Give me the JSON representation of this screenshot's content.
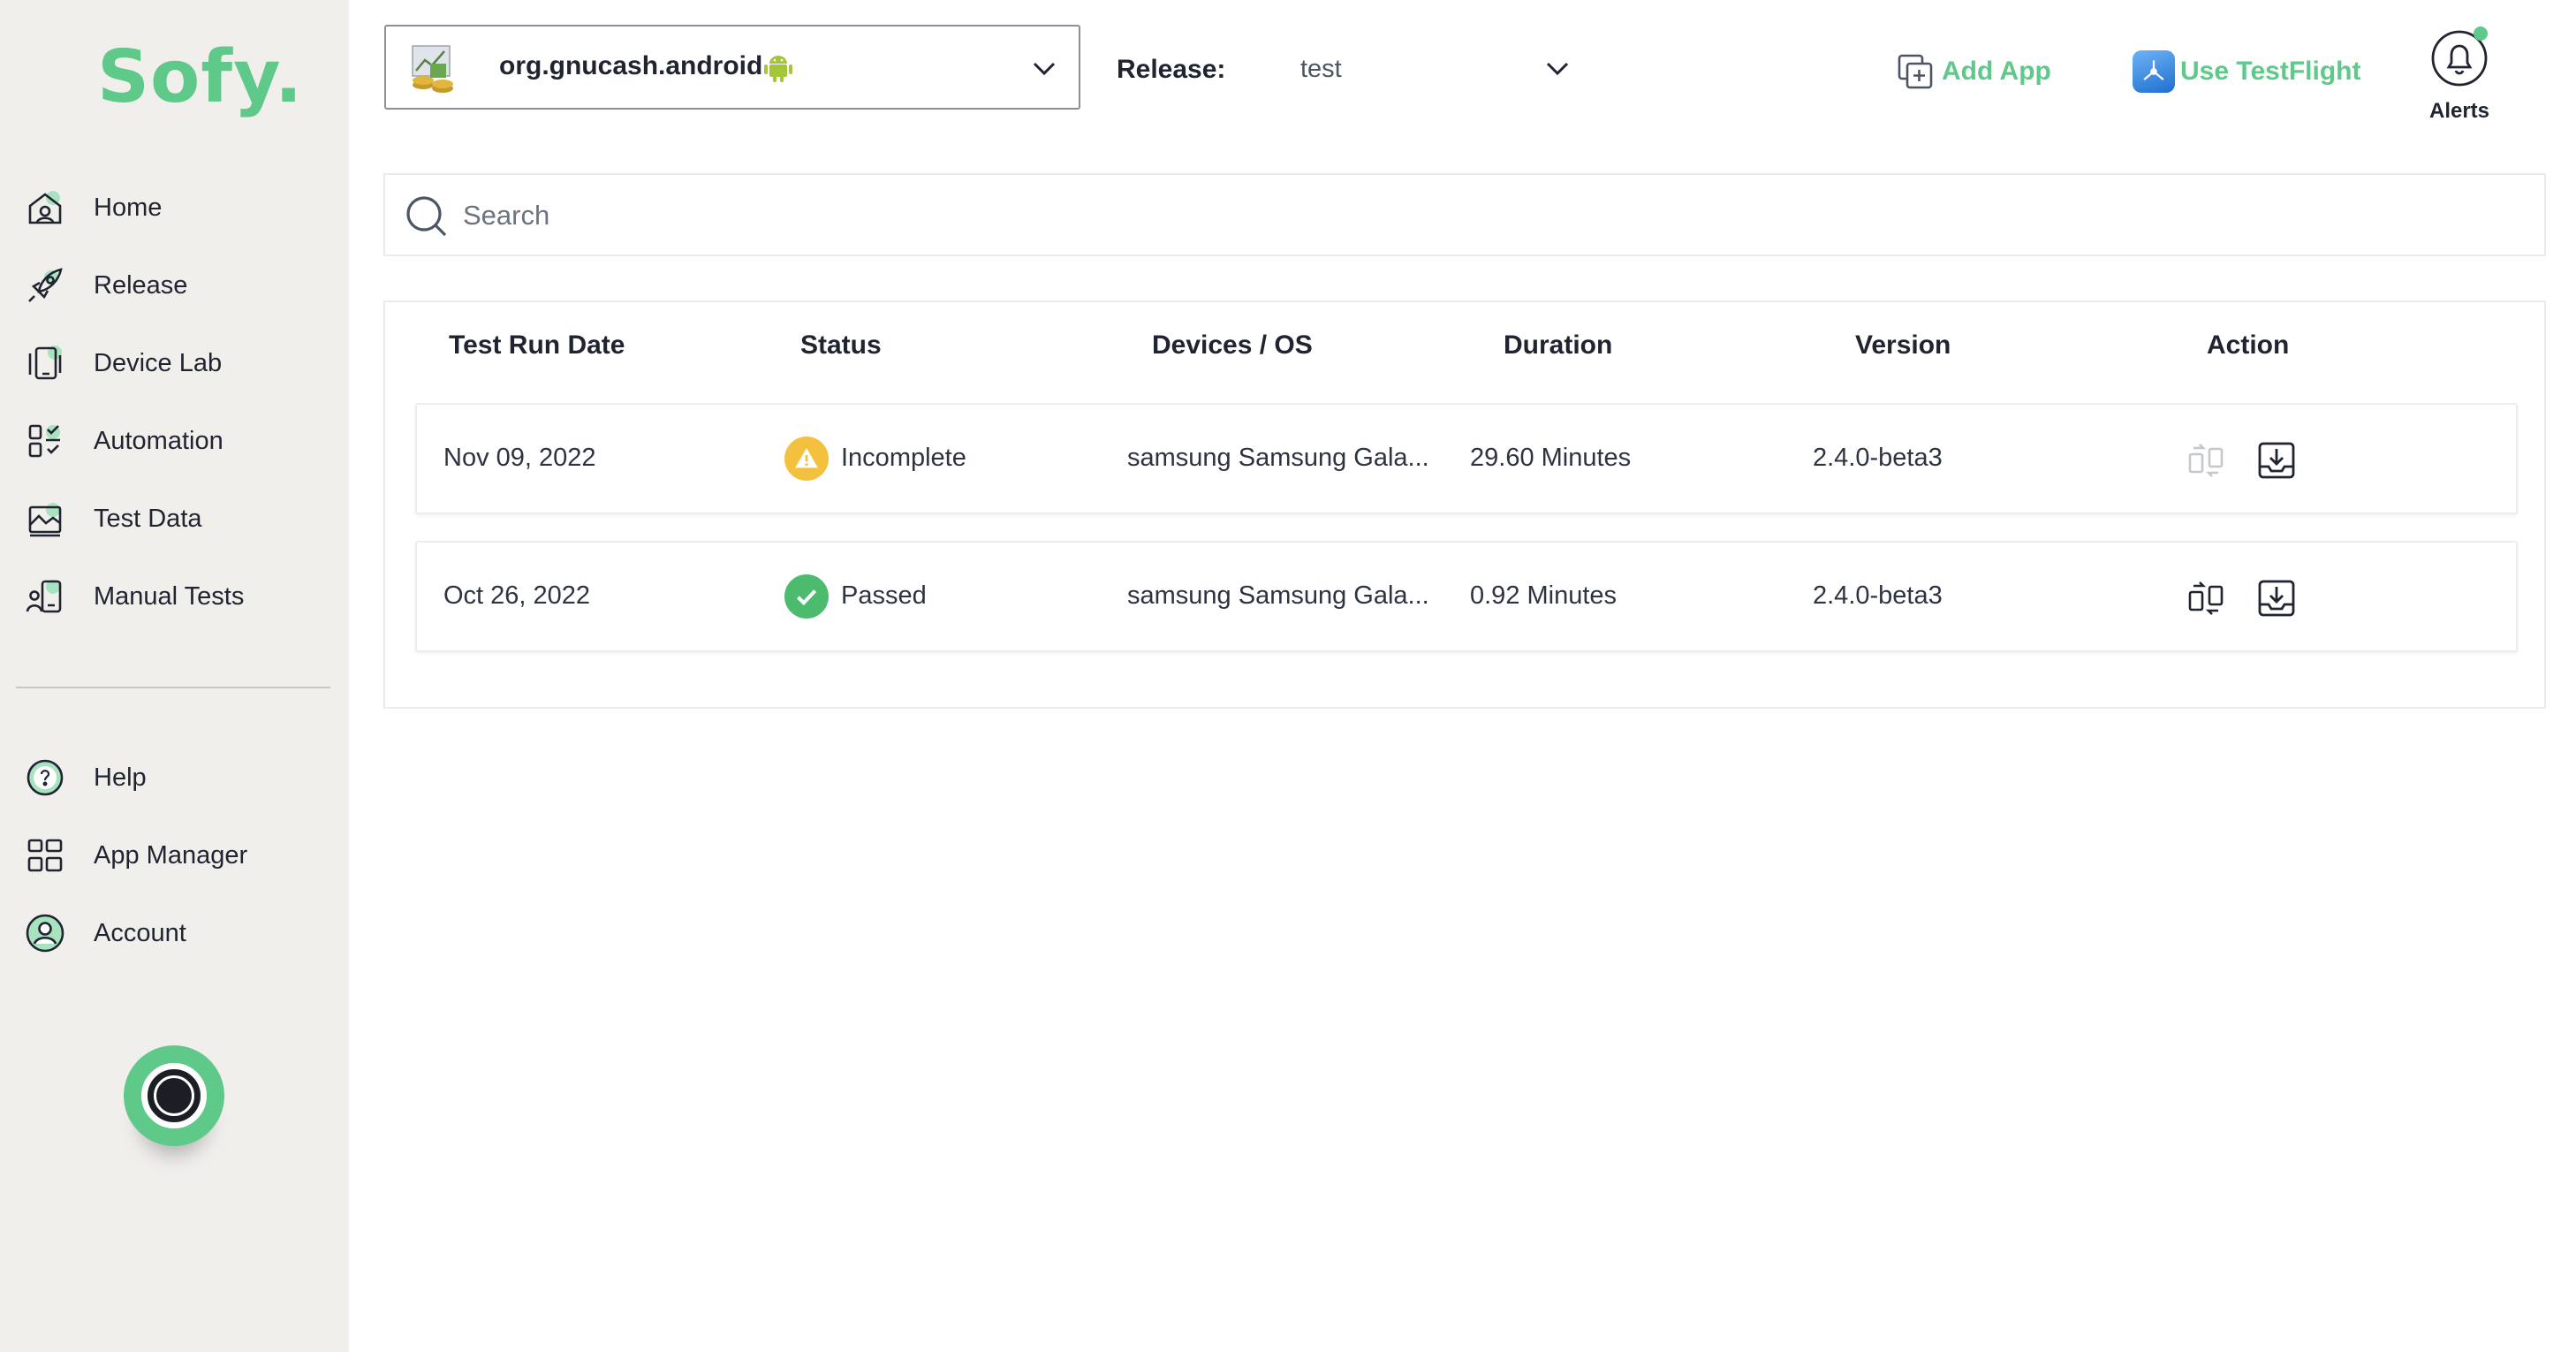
{
  "sidebar": {
    "logo": "Sofy.",
    "items": [
      {
        "label": "Home",
        "icon": "home-icon"
      },
      {
        "label": "Release",
        "icon": "rocket-icon"
      },
      {
        "label": "Device Lab",
        "icon": "device-icon"
      },
      {
        "label": "Automation",
        "icon": "automation-icon"
      },
      {
        "label": "Test Data",
        "icon": "test-data-icon"
      },
      {
        "label": "Manual Tests",
        "icon": "manual-tests-icon"
      }
    ],
    "bottom_items": [
      {
        "label": "Help",
        "icon": "help-icon"
      },
      {
        "label": "App Manager",
        "icon": "app-manager-icon"
      },
      {
        "label": "Account",
        "icon": "account-icon"
      }
    ]
  },
  "topbar": {
    "app_name": "org.gnucash.android",
    "release_label": "Release:",
    "release_value": "test",
    "add_app": "Add App",
    "use_testflight": "Use TestFlight",
    "alerts": "Alerts"
  },
  "search": {
    "placeholder": "Search"
  },
  "table": {
    "headers": [
      "Test Run Date",
      "Status",
      "Devices / OS",
      "Duration",
      "Version",
      "Action"
    ],
    "rows": [
      {
        "date": "Nov 09, 2022",
        "status": "Incomplete",
        "status_type": "warning",
        "device": "samsung Samsung Gala...",
        "duration": "29.60 Minutes",
        "version": "2.4.0-beta3",
        "compare_enabled": false
      },
      {
        "date": "Oct 26, 2022",
        "status": "Passed",
        "status_type": "success",
        "device": "samsung Samsung Gala...",
        "duration": "0.92 Minutes",
        "version": "2.4.0-beta3",
        "compare_enabled": true
      }
    ]
  },
  "colors": {
    "accent": "#5ec989",
    "warning": "#f4c13f",
    "success": "#4cbb6e",
    "sidebar_bg": "#f1efec"
  }
}
